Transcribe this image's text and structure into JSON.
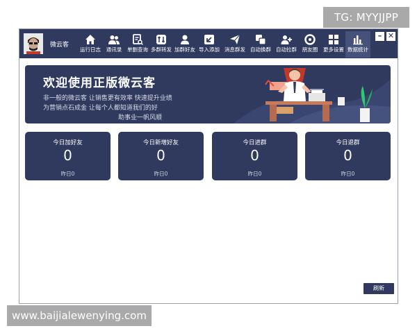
{
  "watermarks": {
    "top": "TG: MYYJJPP",
    "bottom": "www.baijialewenying.com"
  },
  "window": {
    "app_name": "微云客",
    "minimize_label": "–",
    "close_label": "✕"
  },
  "toolbar": {
    "items": [
      {
        "label": "运行日志",
        "icon": "home-icon"
      },
      {
        "label": "通讯录",
        "icon": "contacts-icon"
      },
      {
        "label": "单删查询",
        "icon": "document-search-icon"
      },
      {
        "label": "多群转发",
        "icon": "forward-icon"
      },
      {
        "label": "加群好友",
        "icon": "add-friend-icon"
      },
      {
        "label": "导入添加",
        "icon": "import-icon"
      },
      {
        "label": "消息群发",
        "icon": "send-icon"
      },
      {
        "label": "自动换群",
        "icon": "switch-group-icon"
      },
      {
        "label": "自动拉群",
        "icon": "pull-group-icon"
      },
      {
        "label": "朋友圈",
        "icon": "moments-icon"
      },
      {
        "label": "更多设置",
        "icon": "grid-icon"
      },
      {
        "label": "数据统计",
        "icon": "bar-chart-icon"
      }
    ]
  },
  "banner": {
    "title": "欢迎使用正版微云客",
    "line1": "非一般的微云客  让销售更有效率  快速提升业绩",
    "line2": "为营销点石成金  让每个人都知道我们的好",
    "line3": "助事业一帆风顺"
  },
  "stats": [
    {
      "title": "今日加好友",
      "value": "0",
      "yesterday": "昨日0"
    },
    {
      "title": "今日新增好友",
      "value": "0",
      "yesterday": "昨日0"
    },
    {
      "title": "今日进群",
      "value": "0",
      "yesterday": "昨日0"
    },
    {
      "title": "今日退群",
      "value": "0",
      "yesterday": "昨日0"
    }
  ],
  "actions": {
    "refresh_label": "刷新"
  },
  "colors": {
    "primary": "#2f3a5e",
    "active_tab": "#46527a",
    "watermark": "#a9a9a9"
  }
}
